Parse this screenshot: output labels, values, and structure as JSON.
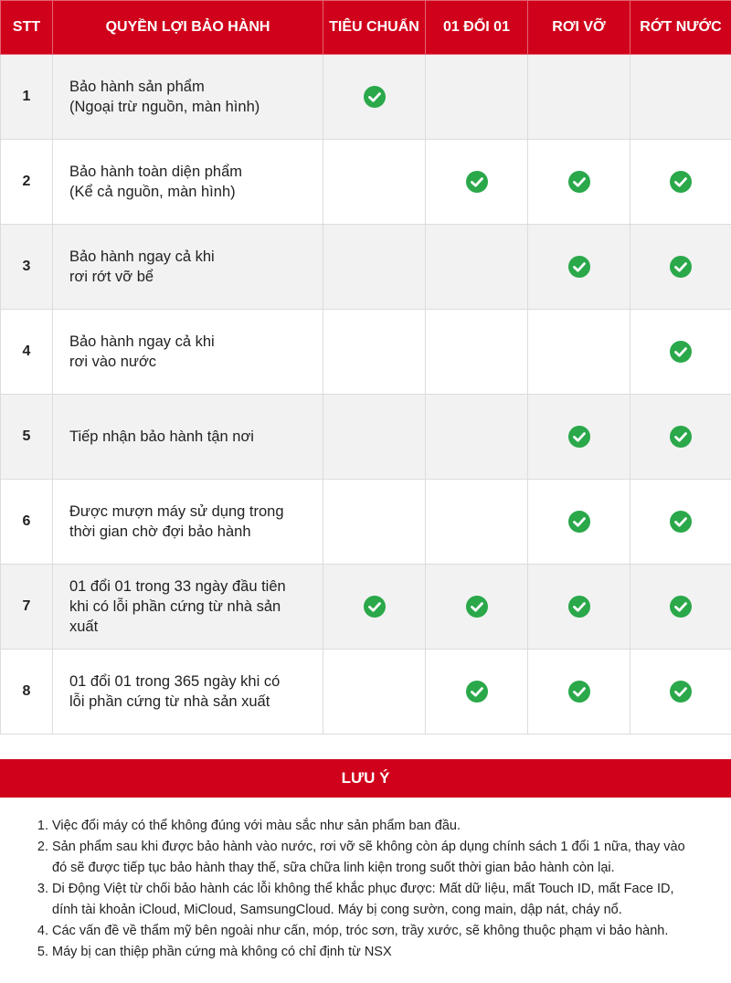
{
  "table": {
    "headers": [
      "STT",
      "QUYỀN LỢI BẢO HÀNH",
      "TIÊU CHUẨN",
      "01 ĐỔI 01",
      "RƠI VỠ",
      "RỚT NƯỚC"
    ],
    "rows": [
      {
        "stt": "1",
        "lines": [
          "Bảo hành sản phẩm",
          "(Ngoại trừ nguồn, màn hình)"
        ],
        "checks": [
          true,
          false,
          false,
          false
        ]
      },
      {
        "stt": "2",
        "lines": [
          "Bảo hành toàn diện phẩm",
          "(Kể cả nguồn, màn hình)"
        ],
        "checks": [
          false,
          true,
          true,
          true
        ]
      },
      {
        "stt": "3",
        "lines": [
          "Bảo hành ngay cả khi",
          "rơi rớt vỡ bể"
        ],
        "checks": [
          false,
          false,
          true,
          true
        ]
      },
      {
        "stt": "4",
        "lines": [
          "Bảo hành ngay cả khi",
          "rơi vào nước"
        ],
        "checks": [
          false,
          false,
          false,
          true
        ]
      },
      {
        "stt": "5",
        "lines": [
          "Tiếp nhận bảo hành tận nơi"
        ],
        "checks": [
          false,
          false,
          true,
          true
        ]
      },
      {
        "stt": "6",
        "lines": [
          "Được mượn máy sử dụng trong",
          "thời gian chờ đợi bảo hành"
        ],
        "checks": [
          false,
          false,
          true,
          true
        ]
      },
      {
        "stt": "7",
        "lines": [
          "01 đổi 01 trong 33 ngày đầu tiên",
          "khi có lỗi phần cứng từ nhà sản",
          "xuất"
        ],
        "checks": [
          true,
          true,
          true,
          true
        ]
      },
      {
        "stt": "8",
        "lines": [
          "01 đổi 01 trong 365 ngày khi có",
          "lỗi phần cứng từ nhà sản xuất"
        ],
        "checks": [
          false,
          true,
          true,
          true
        ]
      }
    ]
  },
  "notes": {
    "title": "LƯU Ý",
    "items": [
      "Việc đổi máy có thể không đúng với màu sắc như sản phẩm ban đầu.",
      "Sản phẩm sau khi được bảo hành vào nước, rơi vỡ sẽ không còn áp dụng chính sách 1 đổi 1 nữa, thay vào đó sẽ được  tiếp tục bảo hành thay thế, sữa chữa linh kiện trong suốt thời gian bảo hành còn lại.",
      "Di Động Việt từ chối bảo hành các lỗi không thể khắc phục được: Mất dữ liệu, mất Touch ID, mất Face ID, dính tài khoản iCloud, MiCloud, SamsungCloud. Máy bị cong sườn, cong main, dập nát, cháy nổ.",
      "Các vấn đề về thẩm mỹ bên ngoài như cấn, móp, tróc sơn, trầy xước, sẽ không thuộc phạm vi bảo hành.",
      "Máy bị can thiệp phần cứng mà không có chỉ định từ NSX"
    ]
  },
  "colors": {
    "accent": "#d0021b",
    "check": "#2aa84a",
    "row_alt": "#f2f2f2"
  },
  "icons": {
    "check": "check-circle-icon"
  }
}
